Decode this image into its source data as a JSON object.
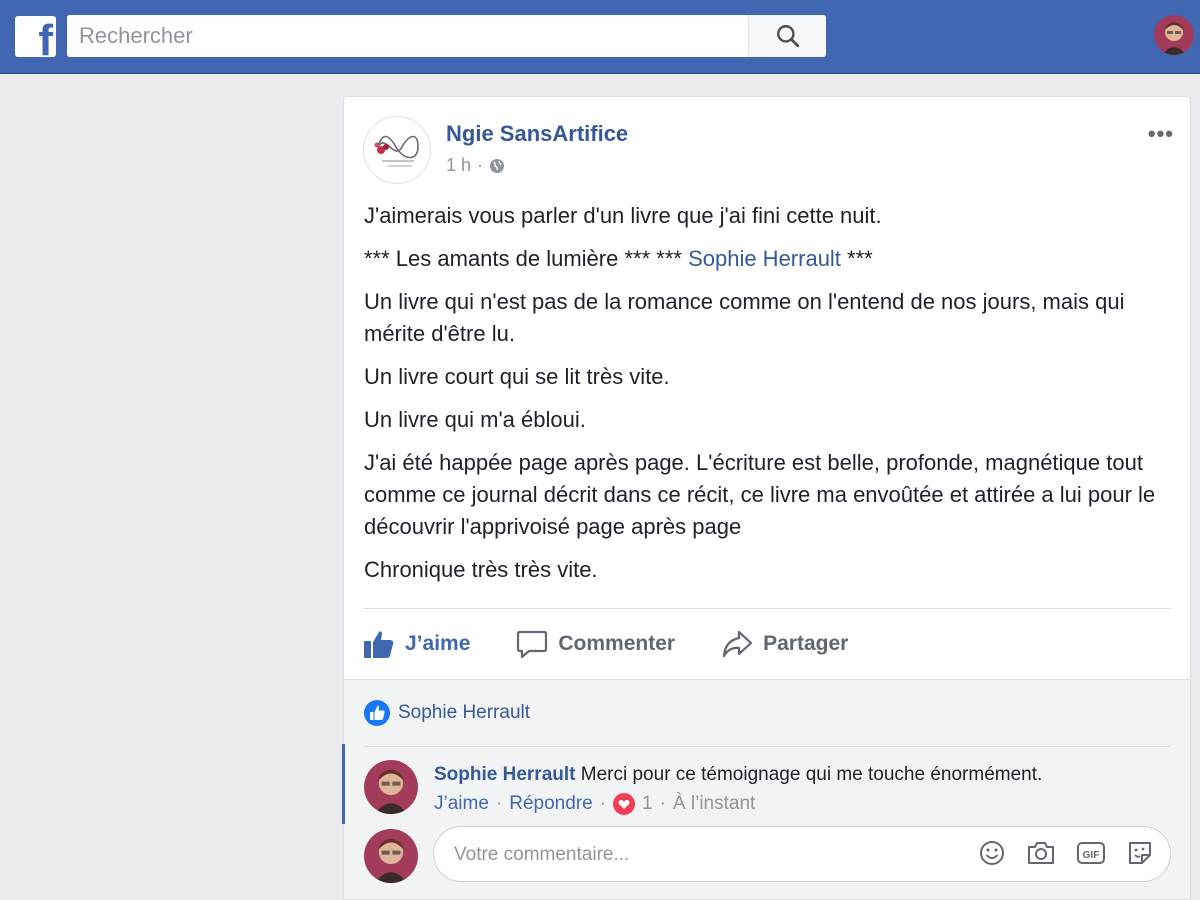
{
  "header": {
    "logo_letter": "f",
    "search_placeholder": "Rechercher",
    "brand_color": "#4267b2"
  },
  "post": {
    "author": "Ngie SansArtifice",
    "time": "1 h",
    "privacy_icon": "globe-icon",
    "paragraphs": {
      "p1": "J'aimerais vous parler d'un livre que j'ai fini cette nuit.",
      "p2_prefix": "*** Les amants de lumière *** *** ",
      "p2_link": "Sophie Herrault",
      "p2_suffix": " ***",
      "p3": "Un livre qui n'est pas de la romance comme on l'entend de nos jours, mais qui mérite d'être lu.",
      "p4": "Un livre court qui se lit très vite.",
      "p5": "Un livre qui m'a ébloui.",
      "p6": "J'ai été happée page après page. L'écriture est belle, profonde, magnétique tout comme ce journal décrit dans ce récit, ce livre ma envoûtée et attirée a lui pour le découvrir l'apprivoisé page après page",
      "p7": "Chronique très très vite."
    }
  },
  "actions": {
    "like": "J’aime",
    "comment": "Commenter",
    "share": "Partager"
  },
  "reactions": {
    "liked_by": "Sophie Herrault"
  },
  "comment": {
    "author": "Sophie Herrault",
    "text": "Merci pour ce témoignage qui me touche énormément.",
    "like": "J’aime",
    "reply": "Répondre",
    "reaction_count": "1",
    "time": "À l’instant",
    "sep": "·"
  },
  "composer": {
    "placeholder": "Votre commentaire...",
    "icons": [
      "emoji-icon",
      "camera-icon",
      "gif-icon",
      "sticker-icon"
    ]
  }
}
